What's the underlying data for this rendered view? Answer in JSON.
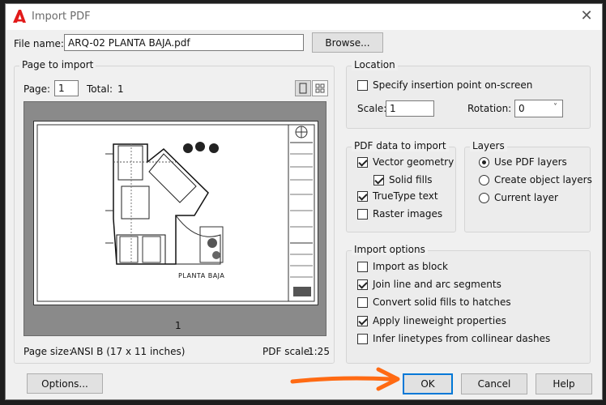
{
  "window": {
    "title": "Import PDF"
  },
  "file": {
    "label": "File name:",
    "value": "ARQ-02 PLANTA BAJA.pdf",
    "browse_label": "Browse..."
  },
  "page_to_import": {
    "title": "Page to import",
    "page_label": "Page:",
    "page_value": "1",
    "total_label": "Total:",
    "total_value": "1",
    "page_number": "1",
    "drawing_label": "PLANTA BAJA",
    "page_size_label": "Page size:",
    "page_size_value": "ANSI B (17 x 11 inches)",
    "pdf_scale_label": "PDF scale:",
    "pdf_scale_value": "1:25"
  },
  "location": {
    "title": "Location",
    "specify_label": "Specify insertion point on-screen",
    "specify_checked": false,
    "scale_label": "Scale:",
    "scale_value": "1",
    "rotation_label": "Rotation:",
    "rotation_value": "0"
  },
  "pdf_data": {
    "title": "PDF data to import",
    "items": [
      {
        "label": "Vector geometry",
        "checked": true
      },
      {
        "label": "Solid fills",
        "checked": true
      },
      {
        "label": "TrueType text",
        "checked": true
      },
      {
        "label": "Raster images",
        "checked": false
      }
    ]
  },
  "layers": {
    "title": "Layers",
    "options": [
      {
        "label": "Use PDF layers",
        "selected": true
      },
      {
        "label": "Create object layers",
        "selected": false
      },
      {
        "label": "Current layer",
        "selected": false
      }
    ]
  },
  "import_options": {
    "title": "Import options",
    "items": [
      {
        "label": "Import as block",
        "checked": false
      },
      {
        "label": "Join line and arc segments",
        "checked": true
      },
      {
        "label": "Convert solid fills to hatches",
        "checked": false
      },
      {
        "label": "Apply lineweight properties",
        "checked": true
      },
      {
        "label": "Infer linetypes from collinear dashes",
        "checked": false
      }
    ]
  },
  "buttons": {
    "options": "Options...",
    "ok": "OK",
    "cancel": "Cancel",
    "help": "Help"
  },
  "colors": {
    "accent": "#0078d7",
    "arrow": "#ff6a13",
    "brand": "#e21a1a"
  }
}
